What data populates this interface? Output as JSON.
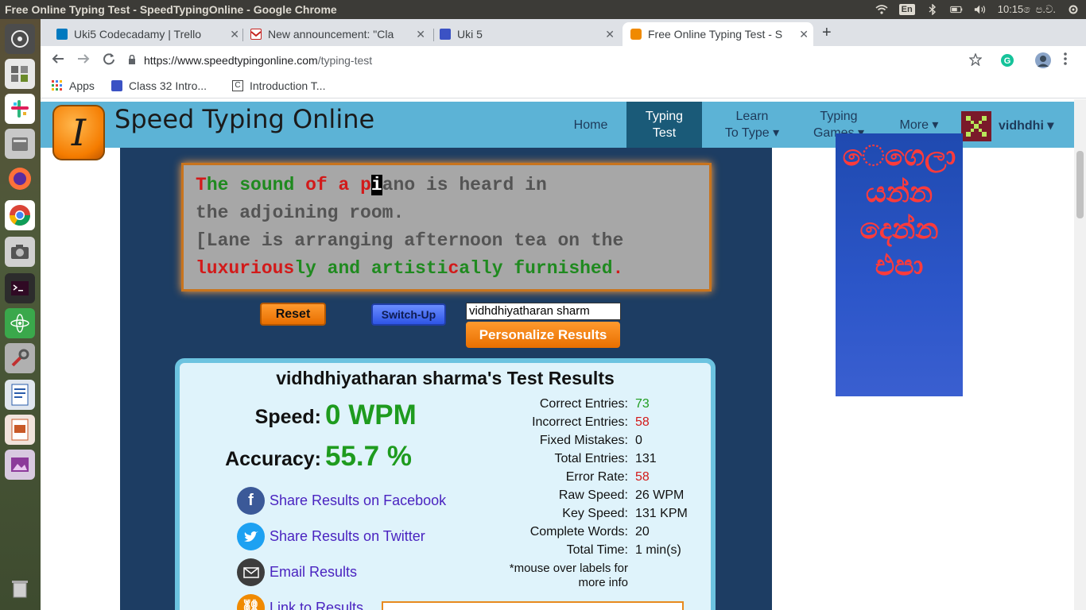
{
  "os": {
    "window_title": "Free Online Typing Test - SpeedTypingOnline - Google Chrome",
    "lang": "En",
    "clock": "10:15 ෙප.ව."
  },
  "tabs": [
    {
      "label": "Uki5 Codecadamy | Trello"
    },
    {
      "label": "New announcement: \"Cla"
    },
    {
      "label": "Uki 5"
    },
    {
      "label": "Free Online Typing Test - S"
    }
  ],
  "omnibox": {
    "url_host": "https://www.speedtypingonline.com",
    "url_path": "/typing-test"
  },
  "bookmarks": [
    {
      "label": "Apps"
    },
    {
      "label": "Class 32 Intro..."
    },
    {
      "label": "Introduction T..."
    }
  ],
  "site": {
    "logo_letter": "I",
    "logo_text": "Speed Typing Online",
    "nav": {
      "home": "Home",
      "typing_test_1": "Typing",
      "typing_test_2": "Test",
      "learn_1": "Learn",
      "learn_2": "To Type",
      "games_1": "Typing",
      "games_2": "Games",
      "more": "More",
      "user": "vidhdhi"
    }
  },
  "typing_text": {
    "line1_a": "T",
    "line1_b": "he",
    "line1_c": " ",
    "line1_d": "sound",
    "line1_e": " ",
    "line1_f": "of",
    "line1_g": " ",
    "line1_h": "a",
    "line1_i": " ",
    "line1_j": "p",
    "line1_k": "i",
    "line1_l": "ano is heard in",
    "line2": "the adjoining room.",
    "line3": "[Lane is arranging afternoon tea on the",
    "line4_a": "luxurious",
    "line4_b": "ly and artisti",
    "line4_c": "c",
    "line4_d": "ally",
    "line4_e": " furnished",
    "line4_f": "."
  },
  "controls": {
    "reset": "Reset",
    "switch_up": "Switch-Up",
    "name_value": "vidhdhiyatharan sharm",
    "personalize": "Personalize Results"
  },
  "results": {
    "title": "vidhdhiyatharan sharma's Test Results",
    "speed_label": "Speed:",
    "speed_value": "0 WPM",
    "accuracy_label": "Accuracy:",
    "accuracy_value": "55.7 %",
    "stats": [
      {
        "label": "Correct Entries:",
        "value": "73"
      },
      {
        "label": "Incorrect Entries:",
        "value": "58"
      },
      {
        "label": "Fixed Mistakes:",
        "value": "0"
      },
      {
        "label": "Total Entries:",
        "value": "131"
      },
      {
        "label": "Error Rate:",
        "value": "58"
      },
      {
        "label": "Raw Speed:",
        "value": "26 WPM"
      },
      {
        "label": "Key Speed:",
        "value": "131 KPM"
      },
      {
        "label": "Complete Words:",
        "value": "20"
      },
      {
        "label": "Total Time:",
        "value": "1 min(s)"
      }
    ],
    "note_1": "*mouse over labels for",
    "note_2": "more info",
    "share_facebook": "Share Results on Facebook",
    "share_twitter": "Share Results on Twitter",
    "email": "Email Results",
    "link": "Link to Results"
  },
  "ad": {
    "line1": "ෙගෙලා",
    "line2": "යන්න",
    "line3": "දෙන්න",
    "line4": "එපා"
  }
}
